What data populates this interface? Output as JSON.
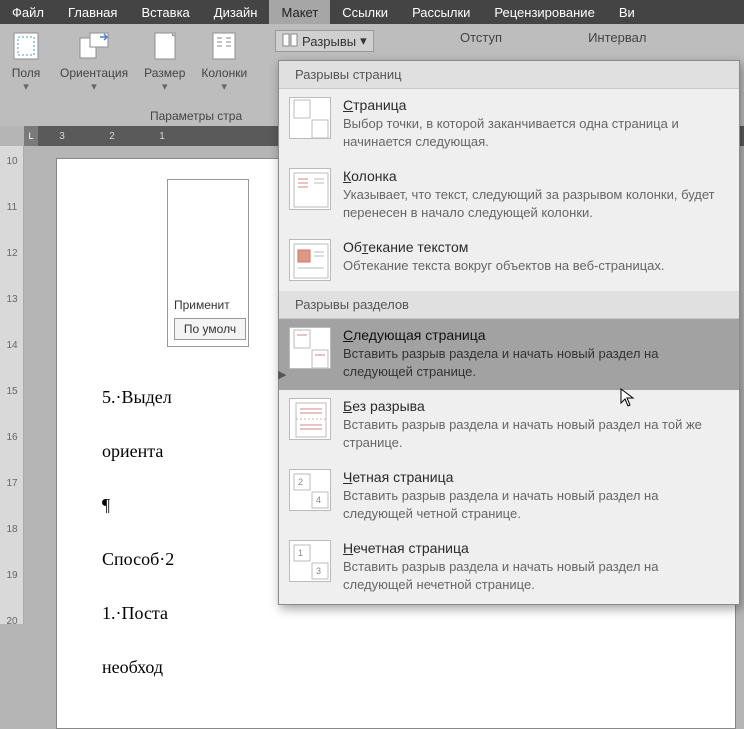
{
  "menu": {
    "items": [
      "Файл",
      "Главная",
      "Вставка",
      "Дизайн",
      "Макет",
      "Ссылки",
      "Рассылки",
      "Рецензирование",
      "Ви"
    ],
    "active": 4
  },
  "ribbon": {
    "groups": [
      {
        "label": "Поля",
        "has_drop": true
      },
      {
        "label": "Ориентация",
        "has_drop": true
      },
      {
        "label": "Размер",
        "has_drop": true
      },
      {
        "label": "Колонки",
        "has_drop": true
      }
    ],
    "footer": "Параметры стра",
    "breaks_button": "Разрывы",
    "right_labels": [
      "Отступ",
      "Интервал"
    ]
  },
  "hruler": {
    "corner": "L",
    "ticks": [
      "3",
      "2",
      "1"
    ]
  },
  "vruler": {
    "ticks": [
      "10",
      "11",
      "12",
      "13",
      "14",
      "15",
      "16",
      "17",
      "18",
      "19",
      "20"
    ]
  },
  "doc": {
    "dialog": {
      "apply": "Применит",
      "default_btn": "По умолч"
    },
    "lines": {
      "l1": "5.·Выдел",
      "l2": "ориента",
      "sep": "¶",
      "l3": "Способ·2",
      "l4": "1.·Поста",
      "l5": "необход"
    }
  },
  "dropdown": {
    "sections": [
      {
        "header": "Разрывы страниц",
        "items": [
          {
            "title": "Страница",
            "u": "С",
            "desc": "Выбор точки, в которой заканчивается одна страница и начинается следующая."
          },
          {
            "title": "Колонка",
            "u": "К",
            "desc": "Указывает, что текст, следующий за разрывом колонки, будет перенесен в начало следующей колонки."
          },
          {
            "title": "Обтекание текстом",
            "u": "т",
            "desc": "Обтекание текста вокруг объектов на веб-страницах."
          }
        ]
      },
      {
        "header": "Разрывы разделов",
        "items": [
          {
            "title": "Следующая страница",
            "u": "С",
            "hovered": true,
            "desc": "Вставить разрыв раздела и начать новый раздел на следующей странице."
          },
          {
            "title": "Без разрыва",
            "u": "Б",
            "desc": "Вставить разрыв раздела и начать новый раздел на той же странице."
          },
          {
            "title": "Четная страница",
            "u": "Ч",
            "desc": "Вставить разрыв раздела и начать новый раздел на следующей четной странице."
          },
          {
            "title": "Нечетная страница",
            "u": "Н",
            "desc": "Вставить разрыв раздела и начать новый раздел на следующей нечетной странице."
          }
        ]
      }
    ]
  }
}
